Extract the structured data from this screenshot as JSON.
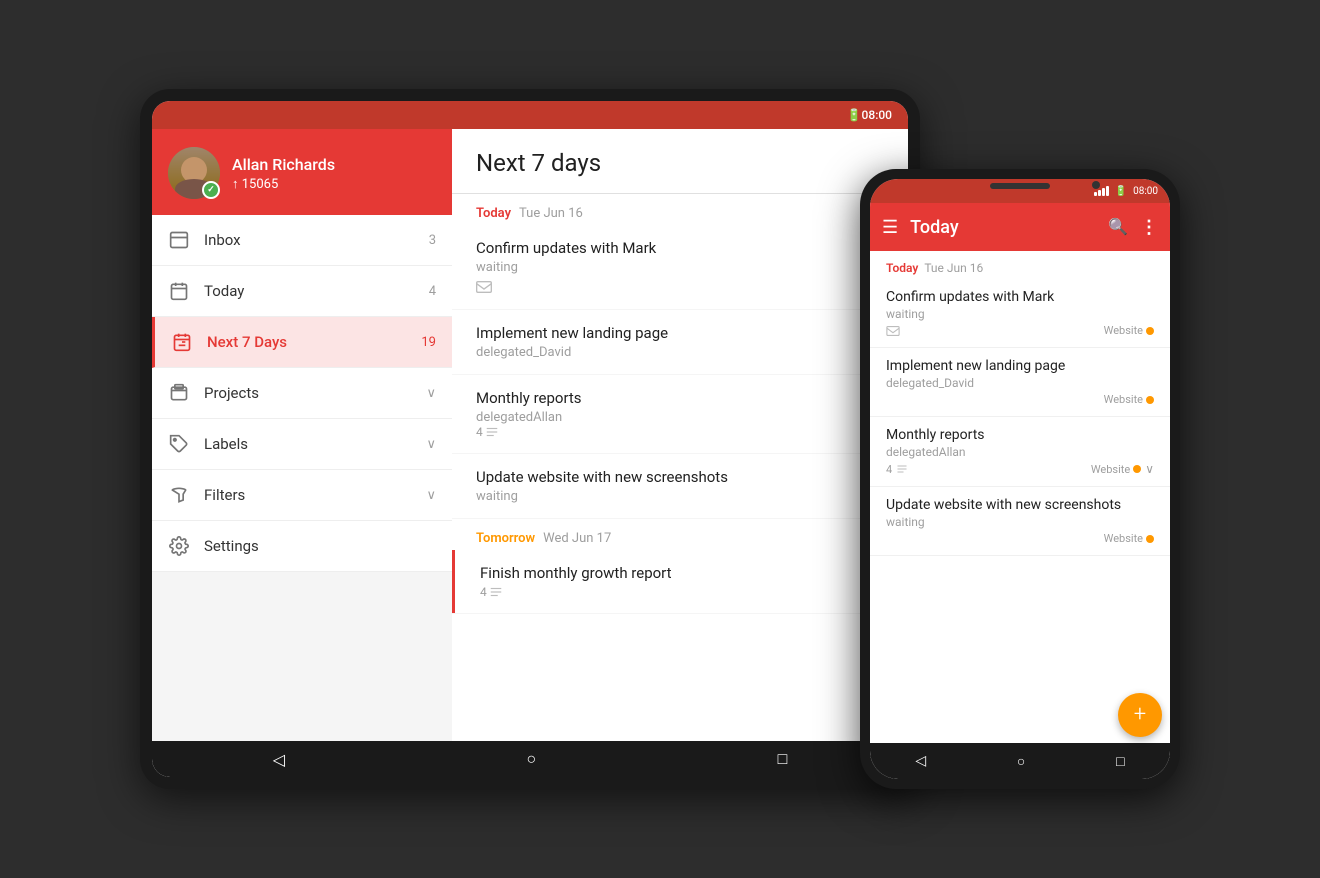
{
  "tablet": {
    "status_bar": {
      "battery_icon": "🔋",
      "time": "08:00"
    },
    "sidebar": {
      "user": {
        "name": "Allan Richards",
        "karma": "↑ 15065"
      },
      "nav_items": [
        {
          "id": "inbox",
          "label": "Inbox",
          "count": "3",
          "active": false
        },
        {
          "id": "today",
          "label": "Today",
          "count": "4",
          "active": false
        },
        {
          "id": "next7days",
          "label": "Next 7 Days",
          "count": "19",
          "active": true
        },
        {
          "id": "projects",
          "label": "Projects",
          "count": "",
          "has_chevron": true,
          "active": false
        },
        {
          "id": "labels",
          "label": "Labels",
          "count": "",
          "has_chevron": true,
          "active": false
        },
        {
          "id": "filters",
          "label": "Filters",
          "count": "",
          "has_chevron": true,
          "active": false
        },
        {
          "id": "settings",
          "label": "Settings",
          "count": "",
          "active": false
        }
      ]
    },
    "main": {
      "title": "Next 7 days",
      "sections": [
        {
          "date_label": "Today",
          "date_sub": "Tue Jun 16",
          "type": "today",
          "tasks": [
            {
              "name": "Confirm updates with Mark",
              "meta": "waiting",
              "has_email_icon": true
            },
            {
              "name": "Implement new landing page",
              "meta": "delegated_David"
            },
            {
              "name": "Monthly reports",
              "meta": "delegatedAllan",
              "count": "4",
              "has_list_icon": true
            },
            {
              "name": "Update website with new screenshots",
              "meta": "waiting"
            }
          ]
        },
        {
          "date_label": "Tomorrow",
          "date_sub": "Wed Jun 17",
          "type": "tomorrow",
          "tasks": [
            {
              "name": "Finish monthly growth report",
              "meta": "4",
              "has_list_icon": true
            }
          ]
        }
      ]
    },
    "bottom_nav": [
      "◁",
      "○",
      "□"
    ]
  },
  "phone": {
    "status_bar": {
      "time": "08:00"
    },
    "toolbar": {
      "title": "Today",
      "menu_icon": "☰",
      "search_icon": "🔍",
      "more_icon": "⋮"
    },
    "content": {
      "sections": [
        {
          "date_label": "Today",
          "date_sub": "Tue Jun 16",
          "type": "today",
          "tasks": [
            {
              "name": "Confirm updates with Mark",
              "meta": "waiting",
              "has_email_icon": true,
              "project": "Website"
            },
            {
              "name": "Implement new landing page",
              "meta": "delegated_David",
              "project": "Website"
            },
            {
              "name": "Monthly reports",
              "meta": "delegatedAllan",
              "count": "4",
              "has_list_icon": true,
              "project": "Website",
              "has_chevron": true
            },
            {
              "name": "Update website with new screenshots",
              "meta": "waiting",
              "project": "Website"
            }
          ]
        }
      ]
    },
    "fab_label": "+",
    "bottom_nav": [
      "◁",
      "○",
      "□"
    ]
  }
}
